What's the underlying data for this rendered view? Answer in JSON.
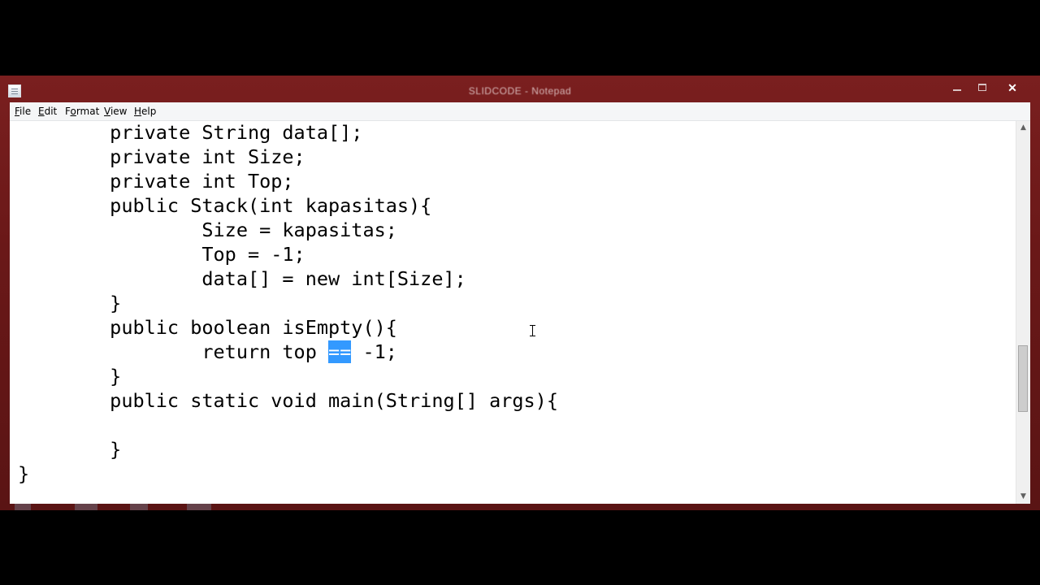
{
  "window": {
    "title": "SLIDCODE - Notepad",
    "minimize_label": "",
    "maximize_label": "",
    "close_label": "✕"
  },
  "menubar": {
    "items": [
      {
        "label_underlined": "F",
        "label_rest": "ile"
      },
      {
        "label_underlined": "E",
        "label_rest": "dit"
      },
      {
        "label_underlined": "o",
        "label_prefix": "F",
        "label_rest": "rmat"
      },
      {
        "label_underlined": "V",
        "label_rest": "iew"
      },
      {
        "label_underlined": "H",
        "label_rest": "elp"
      }
    ]
  },
  "editor": {
    "lines": [
      "        private String data[];",
      "        private int Size;",
      "        private int Top;",
      "        public Stack(int kapasitas){",
      "                Size = kapasitas;",
      "                Top = -1;",
      "                data[] = new int[Size];",
      "        }",
      "        public boolean isEmpty(){",
      "                return top ",
      "        }",
      "        public static void main(String[] args){",
      "",
      "        }",
      "}"
    ],
    "selected_text": "==",
    "after_selection": " -1;"
  },
  "scrollbar": {
    "up_arrow": "▲",
    "down_arrow": "▼"
  }
}
